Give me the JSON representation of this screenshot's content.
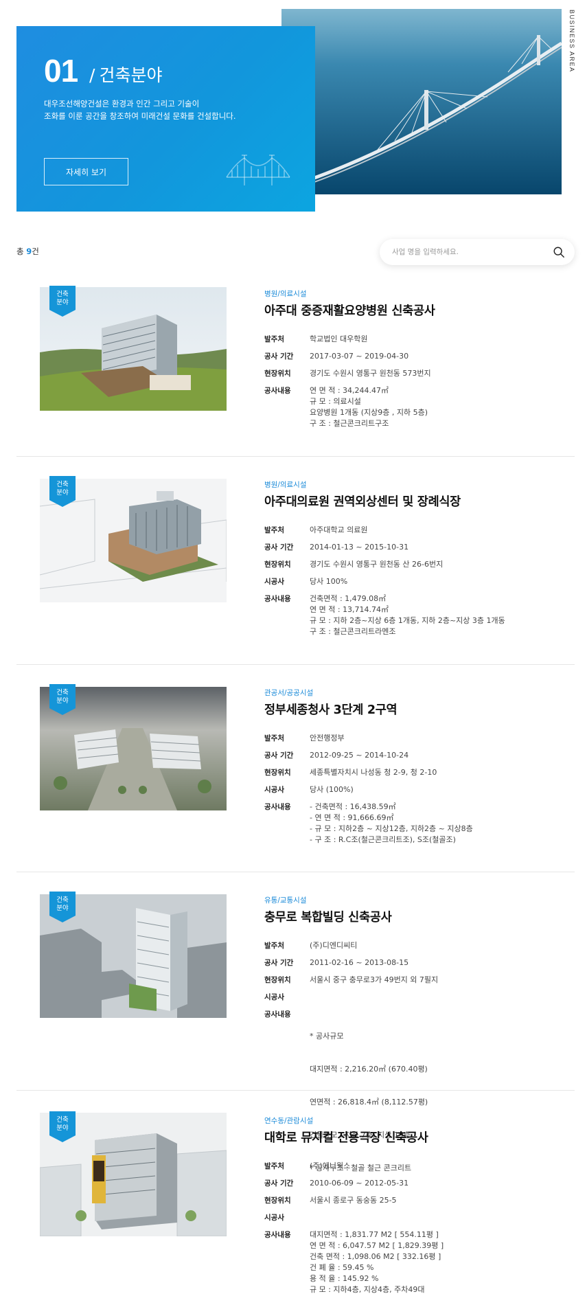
{
  "hero": {
    "number": "01",
    "title": "건축분야",
    "desc_lines": [
      "대우조선해양건설은 환경과 인간 그리고 기술이",
      "조화를 이룬 공간을 창조하여 미래건설 문화를 건설합니다."
    ],
    "button_label": "자세히 보기",
    "side_label": "BUSINESS AREA"
  },
  "toolbar": {
    "count_prefix": "총 ",
    "count_value": "9",
    "count_suffix": "건",
    "search_placeholder": "사업 명을 입력하세요."
  },
  "projects": [
    {
      "badge_lines": [
        "건축",
        "분야"
      ],
      "category": "병원/의료시설",
      "title": "아주대 중증재활요양병원 신축공사",
      "rows": [
        {
          "label": "발주처",
          "lines": [
            "학교법인 대우학원"
          ]
        },
        {
          "label": "공사 기간",
          "lines": [
            "2017-03-07 ~ 2019-04-30"
          ]
        },
        {
          "label": "현장위치",
          "lines": [
            "경기도 수원시 영통구 원천동 573번지"
          ]
        },
        {
          "label": "공사내용",
          "lines": [
            "연 면 적 : 34,244.47㎡",
            "규 모 : 의료시설",
            "요양병원 1개동 (지상9층 , 지하 5층)",
            "구 조 : 철근콘크리트구조"
          ]
        }
      ]
    },
    {
      "badge_lines": [
        "건축",
        "분야"
      ],
      "category": "병원/의료시설",
      "title": "아주대의료원 권역외상센터 및 장례식장",
      "rows": [
        {
          "label": "발주처",
          "lines": [
            "아주대학교 의료원"
          ]
        },
        {
          "label": "공사 기간",
          "lines": [
            "2014-01-13 ~ 2015-10-31"
          ]
        },
        {
          "label": "현장위치",
          "lines": [
            "경기도 수원시 영통구 원천동 산 26-6번지"
          ]
        },
        {
          "label": "시공사",
          "lines": [
            "당사 100%"
          ]
        },
        {
          "label": "공사내용",
          "lines": [
            "건축면적 : 1,479.08㎡",
            "연 면 적 : 13,714.74㎡",
            "규 모 : 지하 2층~지상 6층 1개동, 지하 2층~지상 3층 1개동",
            "구 조 : 철근콘크리트라멘조"
          ]
        }
      ]
    },
    {
      "badge_lines": [
        "건축",
        "분야"
      ],
      "category": "관공서/공공시설",
      "title": "정부세종청사 3단계 2구역",
      "rows": [
        {
          "label": "발주처",
          "lines": [
            "안전행정부"
          ]
        },
        {
          "label": "공사 기간",
          "lines": [
            "2012-09-25 ~ 2014-10-24"
          ]
        },
        {
          "label": "현장위치",
          "lines": [
            "세종특별자치시 나성동 청 2-9, 청 2-10"
          ]
        },
        {
          "label": "시공사",
          "lines": [
            "당사 (100%)"
          ]
        },
        {
          "label": "공사내용",
          "lines": [
            "- 건축면적 : 16,438.59㎡",
            "- 연 면 적 : 91,666.69㎡",
            "- 규 모 : 지하2층 ~ 지상12층, 지하2층 ~ 지상8층",
            "- 구 조 : R.C조(철근콘크리트조), S조(철골조)"
          ]
        }
      ]
    },
    {
      "badge_lines": [
        "건축",
        "분야"
      ],
      "category": "유통/교통시설",
      "title": "충무로 복합빌딩 신축공사",
      "rows": [
        {
          "label": "발주처",
          "lines": [
            "(주)디엔디씨티"
          ]
        },
        {
          "label": "공사 기간",
          "lines": [
            "2011-02-16 ~ 2013-08-15"
          ]
        },
        {
          "label": "현장위치",
          "lines": [
            "서울시 중구 충무로3가 49번지 외 7필지"
          ]
        },
        {
          "label": "시공사",
          "lines": [
            ""
          ]
        },
        {
          "label": "공사내용",
          "lines": [
            "* 공사규모",
            "   대지면적 : 2,216.20㎡ (670.40평)",
            "   연면적 : 26,818.4㎡ (8,112.57평)",
            "   건물규모 : 지하 7층, 지상 19층",
            "* 공사구조 : 철골 철근 콘크리트"
          ]
        }
      ]
    },
    {
      "badge_lines": [
        "건축",
        "분야"
      ],
      "category": "연수동/관람시설",
      "title": "대학로 뮤지컬 전용극장 신축공사",
      "rows": [
        {
          "label": "발주처",
          "lines": [
            "(주)에니웍스"
          ]
        },
        {
          "label": "공사 기간",
          "lines": [
            "2010-06-09 ~ 2012-05-31"
          ]
        },
        {
          "label": "현장위치",
          "lines": [
            "서울시 종로구 동숭동 25-5"
          ]
        },
        {
          "label": "시공사",
          "lines": [
            ""
          ]
        },
        {
          "label": "공사내용",
          "lines": [
            "대지면적 : 1,831.77 M2 [ 554.11평 ]",
            "연 면 적 : 6,047.57 M2 [ 1,829.39평 ]",
            "건축 면적 : 1,098.06 M2 [ 332.16평 ]",
            "건 폐 율 : 59.45 %",
            "용 적 율 : 145.92 %",
            "규 모 : 지하4층, 지상4층, 주차49대"
          ]
        }
      ]
    }
  ]
}
